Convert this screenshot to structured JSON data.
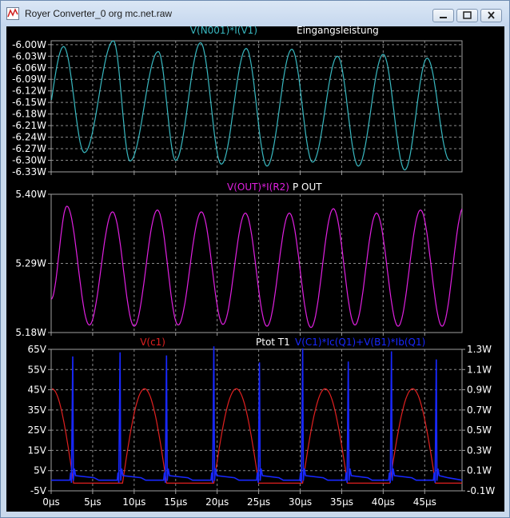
{
  "window": {
    "title": "Royer Converter_0 org mc.net.raw"
  },
  "colors": {
    "cyan": "#38b8c0",
    "magenta": "#e020e0",
    "red": "#e02020",
    "blue": "#1828ff",
    "grid": "#8a8a8a",
    "frame": "#a0a0a0",
    "label": "#ffffff"
  },
  "chart_data": [
    {
      "type": "line",
      "trace_label": "V(N001)*I(V1)",
      "title": "Eingangsleistung",
      "y_ticks": [
        "-6.00W",
        "-6.03W",
        "-6.06W",
        "-6.09W",
        "-6.12W",
        "-6.15W",
        "-6.18W",
        "-6.21W",
        "-6.24W",
        "-6.27W",
        "-6.30W",
        "-6.33W"
      ],
      "ylim": [
        -6.33,
        -5.99
      ],
      "x_ticks": [
        "0µs",
        "5µs",
        "10µs",
        "15µs",
        "20µs",
        "25µs",
        "30µs",
        "35µs",
        "40µs",
        "45µs"
      ],
      "xlim": [
        0,
        49.5
      ],
      "series": [
        {
          "name": "V(N001)*I(V1)",
          "color": "cyan",
          "peaks": [
            [
              1.5,
              -6.005
            ],
            [
              7.5,
              -5.99
            ],
            [
              12.9,
              -6.018
            ],
            [
              18.0,
              -5.995
            ],
            [
              23.5,
              -6.01
            ],
            [
              29.0,
              -6.012
            ],
            [
              34.5,
              -6.03
            ],
            [
              40.0,
              -6.025
            ],
            [
              45.3,
              -6.035
            ]
          ],
          "troughs": [
            [
              -1.2,
              -6.25
            ],
            [
              4.0,
              -6.28
            ],
            [
              9.5,
              -6.302
            ],
            [
              15.0,
              -6.3
            ],
            [
              20.5,
              -6.31
            ],
            [
              26.0,
              -6.315
            ],
            [
              31.5,
              -6.305
            ],
            [
              37.0,
              -6.315
            ],
            [
              42.6,
              -6.325
            ],
            [
              48.0,
              -6.3
            ]
          ]
        }
      ]
    },
    {
      "type": "line",
      "trace_label": "V(OUT)*I(R2)",
      "title": "P OUT",
      "y_ticks": [
        "5.40W",
        "5.29W",
        "5.18W"
      ],
      "ylim": [
        5.18,
        5.4
      ],
      "x_ticks": [
        "0µs",
        "5µs",
        "10µs",
        "15µs",
        "20µs",
        "25µs",
        "30µs",
        "35µs",
        "40µs",
        "45µs"
      ],
      "xlim": [
        0,
        49.5
      ],
      "series": [
        {
          "name": "V(OUT)*I(R2)",
          "color": "magenta",
          "peaks": [
            [
              1.9,
              5.381
            ],
            [
              7.4,
              5.372
            ],
            [
              12.8,
              5.375
            ],
            [
              18.1,
              5.372
            ],
            [
              23.4,
              5.37
            ],
            [
              28.7,
              5.37
            ],
            [
              34.0,
              5.377
            ],
            [
              39.2,
              5.37
            ],
            [
              44.5,
              5.375
            ],
            [
              49.7,
              5.38
            ]
          ],
          "troughs": [
            [
              0.0,
              5.233
            ],
            [
              4.6,
              5.192
            ],
            [
              10.0,
              5.19
            ],
            [
              15.3,
              5.192
            ],
            [
              20.7,
              5.193
            ],
            [
              26.0,
              5.19
            ],
            [
              31.3,
              5.188
            ],
            [
              36.6,
              5.192
            ],
            [
              41.8,
              5.19
            ],
            [
              47.1,
              5.19
            ]
          ]
        }
      ]
    },
    {
      "type": "line",
      "left_label": "V(c1)",
      "title": "Ptot T1",
      "right_label": "V(C1)*Ic(Q1)+V(B1)*Ib(Q1)",
      "y_ticks_left": [
        "65V",
        "55V",
        "45V",
        "35V",
        "25V",
        "15V",
        "5V",
        "-5V"
      ],
      "y_ticks_right": [
        "1.3W",
        "1.1W",
        "0.9W",
        "0.7W",
        "0.5W",
        "0.3W",
        "0.1W",
        "-0.1W"
      ],
      "ylim_left": [
        -5,
        65
      ],
      "ylim_right": [
        -0.1,
        1.3
      ],
      "x_ticks": [
        "0µs",
        "5µs",
        "10µs",
        "15µs",
        "20µs",
        "25µs",
        "30µs",
        "35µs",
        "40µs",
        "45µs"
      ],
      "xlim": [
        0,
        49.5
      ],
      "series": [
        {
          "name": "V(c1)",
          "color": "red",
          "pulses": [
            [
              -2.5,
              2.7
            ],
            [
              8.6,
              13.9
            ],
            [
              19.6,
              25.0
            ],
            [
              30.3,
              35.7
            ],
            [
              40.8,
              46.3
            ]
          ],
          "peak": 45.5,
          "base": -1.2
        },
        {
          "name": "V(C1)*Ic(Q1)+V(B1)*Ib(Q1)",
          "color": "blue",
          "spikes": [
            [
              2.6,
              1.23
            ],
            [
              8.3,
              1.27
            ],
            [
              13.9,
              1.24
            ],
            [
              19.6,
              1.33
            ],
            [
              25.1,
              1.17
            ],
            [
              30.3,
              1.31
            ],
            [
              35.8,
              1.18
            ],
            [
              41.0,
              1.28
            ],
            [
              46.4,
              1.2
            ]
          ],
          "baseline": 0.005,
          "plateau": 0.05
        }
      ]
    }
  ]
}
